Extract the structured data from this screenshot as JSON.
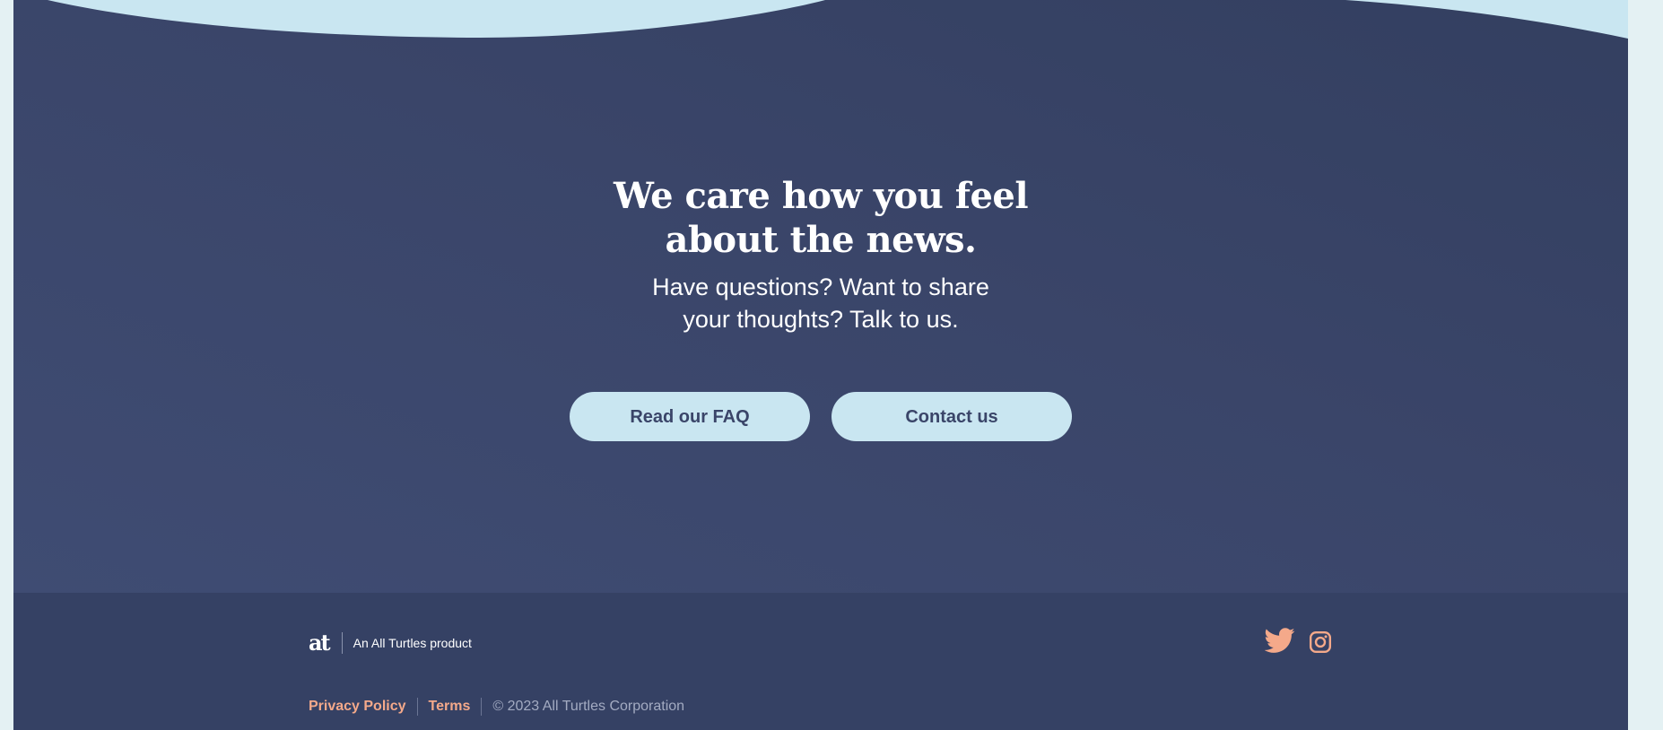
{
  "hero": {
    "headline_line1": "We care how you feel",
    "headline_line2": "about the news.",
    "subtext_line1": "Have questions? Want to share",
    "subtext_line2": "your thoughts? Talk to us.",
    "faq_button": "Read our FAQ",
    "contact_button": "Contact us"
  },
  "footer": {
    "logo_text": "at",
    "tagline": "An All Turtles product",
    "social_icons": [
      "twitter-icon",
      "instagram-icon"
    ],
    "privacy_label": "Privacy Policy",
    "terms_label": "Terms",
    "copyright": "© 2023 All Turtles Corporation"
  },
  "colors": {
    "hero_background": "#3a4569",
    "footer_background": "#354164",
    "button_background": "#c9e6f1",
    "button_text": "#3a4569",
    "accent": "#f4a98a",
    "wave": "#c9e6f1",
    "page_background": "#e4f1f3"
  }
}
